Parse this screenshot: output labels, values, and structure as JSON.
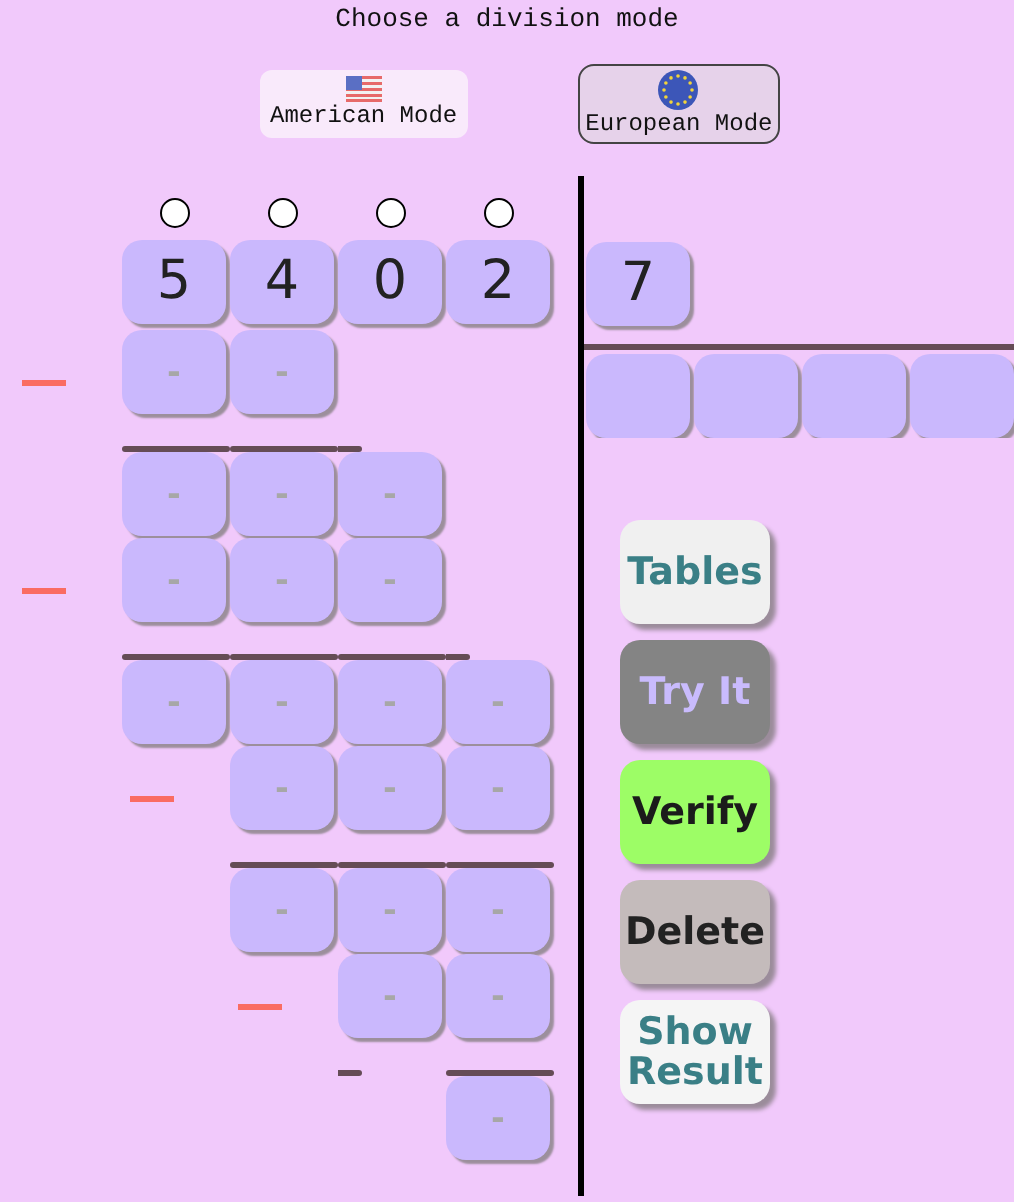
{
  "title": "Choose a division mode",
  "modes": [
    {
      "label": "American Mode",
      "kind": "us",
      "selected": false
    },
    {
      "label": "European Mode",
      "kind": "eu",
      "selected": true
    }
  ],
  "digit_markers": [
    {
      "checked": false
    },
    {
      "checked": false
    },
    {
      "checked": false
    },
    {
      "checked": false
    }
  ],
  "dividend": [
    "5",
    "4",
    "0",
    "2"
  ],
  "divisor": "7",
  "quotient": [
    {
      "kind": "input"
    },
    {
      "kind": "input"
    },
    {
      "kind": "input"
    },
    {
      "kind": "input"
    }
  ],
  "steps": [
    {
      "minus": true,
      "rule": [
        {
          "kind": "none"
        },
        {
          "kind": "none"
        },
        {
          "kind": "none"
        },
        {
          "kind": "none"
        }
      ],
      "cells": [
        {
          "kind": "input",
          "placeholder": "-"
        },
        {
          "kind": "input",
          "placeholder": "-"
        },
        {
          "kind": "blank"
        },
        {
          "kind": "blank"
        }
      ]
    },
    {
      "minus": false,
      "rule": [
        {
          "kind": "line"
        },
        {
          "kind": "line"
        },
        {
          "kind": "short"
        },
        {
          "kind": "none"
        }
      ],
      "cells": [
        {
          "kind": "input",
          "placeholder": "-"
        },
        {
          "kind": "input",
          "placeholder": "-"
        },
        {
          "kind": "input",
          "placeholder": "-"
        },
        {
          "kind": "blank"
        }
      ]
    },
    {
      "minus": true,
      "rule": [
        {
          "kind": "none"
        },
        {
          "kind": "none"
        },
        {
          "kind": "none"
        },
        {
          "kind": "none"
        }
      ],
      "cells": [
        {
          "kind": "input",
          "placeholder": "-"
        },
        {
          "kind": "input",
          "placeholder": "-"
        },
        {
          "kind": "input",
          "placeholder": "-"
        },
        {
          "kind": "blank"
        }
      ]
    },
    {
      "minus": false,
      "rule": [
        {
          "kind": "line"
        },
        {
          "kind": "line"
        },
        {
          "kind": "line"
        },
        {
          "kind": "short"
        }
      ],
      "cells": [
        {
          "kind": "input",
          "placeholder": "-"
        },
        {
          "kind": "input",
          "placeholder": "-"
        },
        {
          "kind": "input",
          "placeholder": "-"
        },
        {
          "kind": "input",
          "placeholder": "-"
        }
      ]
    },
    {
      "minus": true,
      "rule": [
        {
          "kind": "none"
        },
        {
          "kind": "none"
        },
        {
          "kind": "none"
        },
        {
          "kind": "none"
        }
      ],
      "cells": [
        {
          "kind": "blank"
        },
        {
          "kind": "input",
          "placeholder": "-"
        },
        {
          "kind": "input",
          "placeholder": "-"
        },
        {
          "kind": "input",
          "placeholder": "-"
        }
      ]
    },
    {
      "minus": false,
      "rule": [
        {
          "kind": "none"
        },
        {
          "kind": "line"
        },
        {
          "kind": "line"
        },
        {
          "kind": "line"
        }
      ],
      "cells": [
        {
          "kind": "blank"
        },
        {
          "kind": "input",
          "placeholder": "-"
        },
        {
          "kind": "input",
          "placeholder": "-"
        },
        {
          "kind": "input",
          "placeholder": "-"
        }
      ]
    },
    {
      "minus": true,
      "rule": [
        {
          "kind": "none"
        },
        {
          "kind": "none"
        },
        {
          "kind": "none"
        },
        {
          "kind": "none"
        }
      ],
      "cells": [
        {
          "kind": "blank"
        },
        {
          "kind": "blank"
        },
        {
          "kind": "input",
          "placeholder": "-"
        },
        {
          "kind": "input",
          "placeholder": "-"
        }
      ]
    },
    {
      "minus": false,
      "rule": [
        {
          "kind": "none"
        },
        {
          "kind": "none"
        },
        {
          "kind": "short"
        },
        {
          "kind": "line"
        }
      ],
      "cells": [
        {
          "kind": "blank"
        },
        {
          "kind": "blank"
        },
        {
          "kind": "blank"
        },
        {
          "kind": "input",
          "placeholder": "-"
        }
      ]
    }
  ],
  "buttons": [
    {
      "label": "Tables",
      "kind": "tables"
    },
    {
      "label": "Try It",
      "kind": "try"
    },
    {
      "label": "Verify",
      "kind": "verify"
    },
    {
      "label": "Delete",
      "kind": "delete"
    },
    {
      "label": "Show Result",
      "kind": "show"
    }
  ]
}
